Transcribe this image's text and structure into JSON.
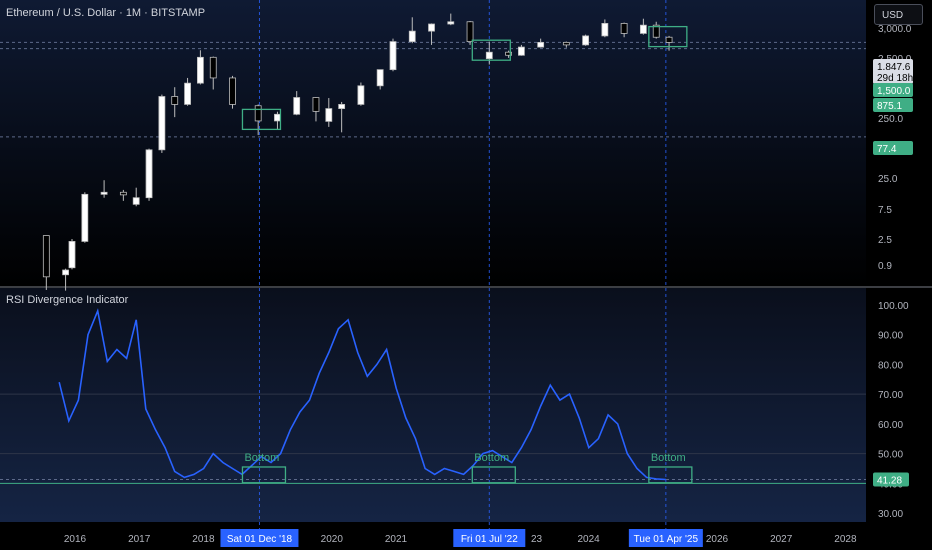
{
  "header": {
    "title": "Ethereum / U.S. Dollar · 1M · BITSTAMP"
  },
  "currency_button": {
    "label": "USD"
  },
  "indicator": {
    "title": "RSI Divergence Indicator"
  },
  "colors": {
    "up": "#ffffff",
    "down": "#000000",
    "wick": "#bdbdbd",
    "rsi_line": "#2962ff",
    "box": "#3fae85",
    "dashed": "#2962ff",
    "badge_green": "#3fae85",
    "badge_dark": "#2a2e39",
    "date_badge": "#2962ff",
    "axis_text": "#b2b5be"
  },
  "chart_data": [
    {
      "type": "candlestick",
      "title": "Ethereum / U.S. Dollar · 1M · BITSTAMP",
      "scale": "log",
      "ylim": [
        0.55,
        3000
      ],
      "y_ticks": [
        "3,000.0",
        "2,500.0",
        "250.0",
        "25.0",
        "7.5",
        "2.5",
        "0.9"
      ],
      "price_labels": [
        {
          "text": "1,847.6",
          "kind": "last"
        },
        {
          "text": "29d 18h",
          "kind": "countdown"
        },
        {
          "text": "1,500.0",
          "kind": "level"
        },
        {
          "text": "875.1",
          "kind": "level"
        },
        {
          "text": "77.4",
          "kind": "level"
        }
      ],
      "ohlc": [
        [
          2015.6,
          2.8,
          2.8,
          0.45,
          0.7
        ],
        [
          2015.9,
          0.75,
          0.92,
          0.44,
          0.88
        ],
        [
          2016.0,
          0.95,
          2.5,
          0.9,
          2.3
        ],
        [
          2016.2,
          2.3,
          12.0,
          2.2,
          11.2
        ],
        [
          2016.5,
          11.2,
          18.0,
          10.0,
          12.0
        ],
        [
          2016.8,
          12.0,
          13.0,
          9.0,
          11.0
        ],
        [
          2017.0,
          8.0,
          14.0,
          7.5,
          10.0
        ],
        [
          2017.2,
          10.0,
          52.0,
          9.0,
          50.0
        ],
        [
          2017.4,
          50.0,
          320.0,
          45.0,
          300.0
        ],
        [
          2017.6,
          300.0,
          410.0,
          150.0,
          230.0
        ],
        [
          2017.8,
          230.0,
          560.0,
          220.0,
          470.0
        ],
        [
          2018.0,
          470.0,
          1420.0,
          450.0,
          1120.0
        ],
        [
          2018.2,
          1120.0,
          1150.0,
          380.0,
          560.0
        ],
        [
          2018.5,
          560.0,
          600.0,
          200.0,
          230.0
        ],
        [
          2018.9,
          220.0,
          230.0,
          82.0,
          132.0
        ],
        [
          2019.2,
          132.0,
          180.0,
          100.0,
          165.0
        ],
        [
          2019.5,
          165.0,
          360.0,
          160.0,
          290.0
        ],
        [
          2019.8,
          290.0,
          295.0,
          130.0,
          182.0
        ],
        [
          2020.0,
          130.0,
          285.0,
          108.0,
          200.0
        ],
        [
          2020.2,
          200.0,
          250.0,
          90.0,
          230.0
        ],
        [
          2020.5,
          230.0,
          480.0,
          220.0,
          430.0
        ],
        [
          2020.8,
          430.0,
          620.0,
          380.0,
          740.0
        ],
        [
          2021.0,
          740.0,
          2100.0,
          700.0,
          1900.0
        ],
        [
          2021.3,
          1900.0,
          4300.0,
          1800.0,
          2700.0
        ],
        [
          2021.6,
          2700.0,
          3500.0,
          1700.0,
          3430.0
        ],
        [
          2021.9,
          3430.0,
          4870.0,
          3300.0,
          3700.0
        ],
        [
          2022.2,
          3700.0,
          3800.0,
          1700.0,
          1900.0
        ],
        [
          2022.5,
          1070.0,
          1900.0,
          880.0,
          1330.0
        ],
        [
          2022.8,
          1330.0,
          1400.0,
          1100.0,
          1200.0
        ],
        [
          2023.0,
          1200.0,
          1700.0,
          1180.0,
          1580.0
        ],
        [
          2023.3,
          1580.0,
          2100.0,
          1550.0,
          1850.0
        ],
        [
          2023.7,
          1850.0,
          1900.0,
          1550.0,
          1700.0
        ],
        [
          2024.0,
          1700.0,
          2400.0,
          1650.0,
          2300.0
        ],
        [
          2024.3,
          2300.0,
          4000.0,
          2200.0,
          3500.0
        ],
        [
          2024.6,
          3500.0,
          3600.0,
          2200.0,
          2500.0
        ],
        [
          2024.9,
          2500.0,
          4100.0,
          2400.0,
          3300.0
        ],
        [
          2025.1,
          3300.0,
          3700.0,
          2100.0,
          2200.0
        ],
        [
          2025.3,
          2200.0,
          2300.0,
          1400.0,
          1847.6
        ]
      ]
    },
    {
      "type": "line",
      "title": "RSI Divergence Indicator",
      "ylim": [
        27,
        103
      ],
      "y_ticks": [
        "100.00",
        "90.00",
        "80.00",
        "70.00",
        "60.00",
        "50.00",
        "40.00",
        "30.00"
      ],
      "reference_lines": [
        70,
        50,
        40
      ],
      "current_value_label": "41.28",
      "series": [
        {
          "x": [
            2015.8,
            2015.95,
            2016.1,
            2016.25,
            2016.4,
            2016.55,
            2016.7,
            2016.85,
            2017.0,
            2017.15,
            2017.3,
            2017.45,
            2017.6,
            2017.75,
            2017.9,
            2018.05,
            2018.2,
            2018.35,
            2018.5,
            2018.65,
            2018.8,
            2018.95,
            2019.1,
            2019.25,
            2019.4,
            2019.55,
            2019.7,
            2019.85,
            2020.0,
            2020.15,
            2020.3,
            2020.45,
            2020.6,
            2020.75,
            2020.9,
            2021.05,
            2021.2,
            2021.35,
            2021.5,
            2021.65,
            2021.8,
            2021.95,
            2022.1,
            2022.25,
            2022.4,
            2022.55,
            2022.7,
            2022.85,
            2023.0,
            2023.15,
            2023.3,
            2023.45,
            2023.6,
            2023.75,
            2023.9,
            2024.05,
            2024.2,
            2024.35,
            2024.5,
            2024.65,
            2024.8,
            2024.95,
            2025.1,
            2025.25
          ],
          "values": [
            74,
            61,
            68,
            90,
            98,
            81,
            85,
            82,
            95,
            65,
            58,
            52,
            44,
            42,
            43,
            45,
            50,
            47,
            45,
            43,
            46,
            49,
            47,
            50,
            58,
            64,
            68,
            77,
            84,
            92,
            95,
            84,
            76,
            80,
            85,
            72,
            62,
            55,
            45,
            43,
            45,
            44,
            43,
            46,
            50,
            51,
            49,
            47,
            52,
            58,
            66,
            73,
            68,
            70,
            62,
            52,
            55,
            63,
            60,
            50,
            45,
            42,
            41.5,
            41.28
          ]
        }
      ],
      "annotations": [
        "Bottom",
        "Bottom",
        "Bottom"
      ]
    }
  ],
  "x_axis": {
    "ticks": [
      "2016",
      "2017",
      "2018",
      "2020",
      "2021",
      "2024",
      "2026",
      "2027",
      "2028"
    ],
    "cursor_labels": [
      "Sat 01 Dec '18",
      "Fri 01 Jul '22",
      "Tue 01 Apr '25"
    ],
    "partial_labels": [
      "20",
      "23"
    ]
  }
}
